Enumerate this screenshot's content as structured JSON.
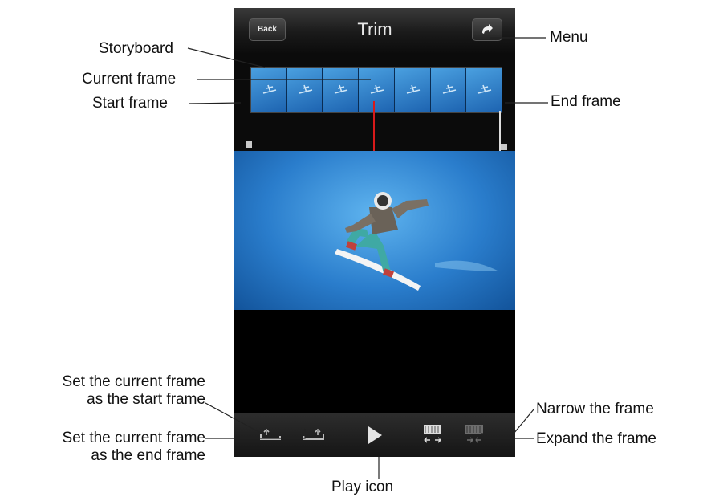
{
  "app": {
    "title": "Trim",
    "back_label": "Back"
  },
  "icons": {
    "menu": "rotate-arrow-icon",
    "set_start": "set-start-frame-icon",
    "set_end": "set-end-frame-icon",
    "play": "play-icon",
    "expand": "expand-frame-icon",
    "narrow": "narrow-frame-icon"
  },
  "callouts": {
    "storyboard": "Storyboard",
    "current_frame": "Current frame",
    "start_frame": "Start frame",
    "menu": "Menu",
    "end_frame": "End frame",
    "set_start_line1": "Set the current frame",
    "set_start_line2": "as the start frame",
    "set_end_line1": "Set the current frame",
    "set_end_line2": "as the end frame",
    "play": "Play icon",
    "narrow": "Narrow the frame",
    "expand": "Expand the frame"
  },
  "colors": {
    "current_frame_marker": "#d81a1a",
    "sky": "#2a7dcc"
  }
}
